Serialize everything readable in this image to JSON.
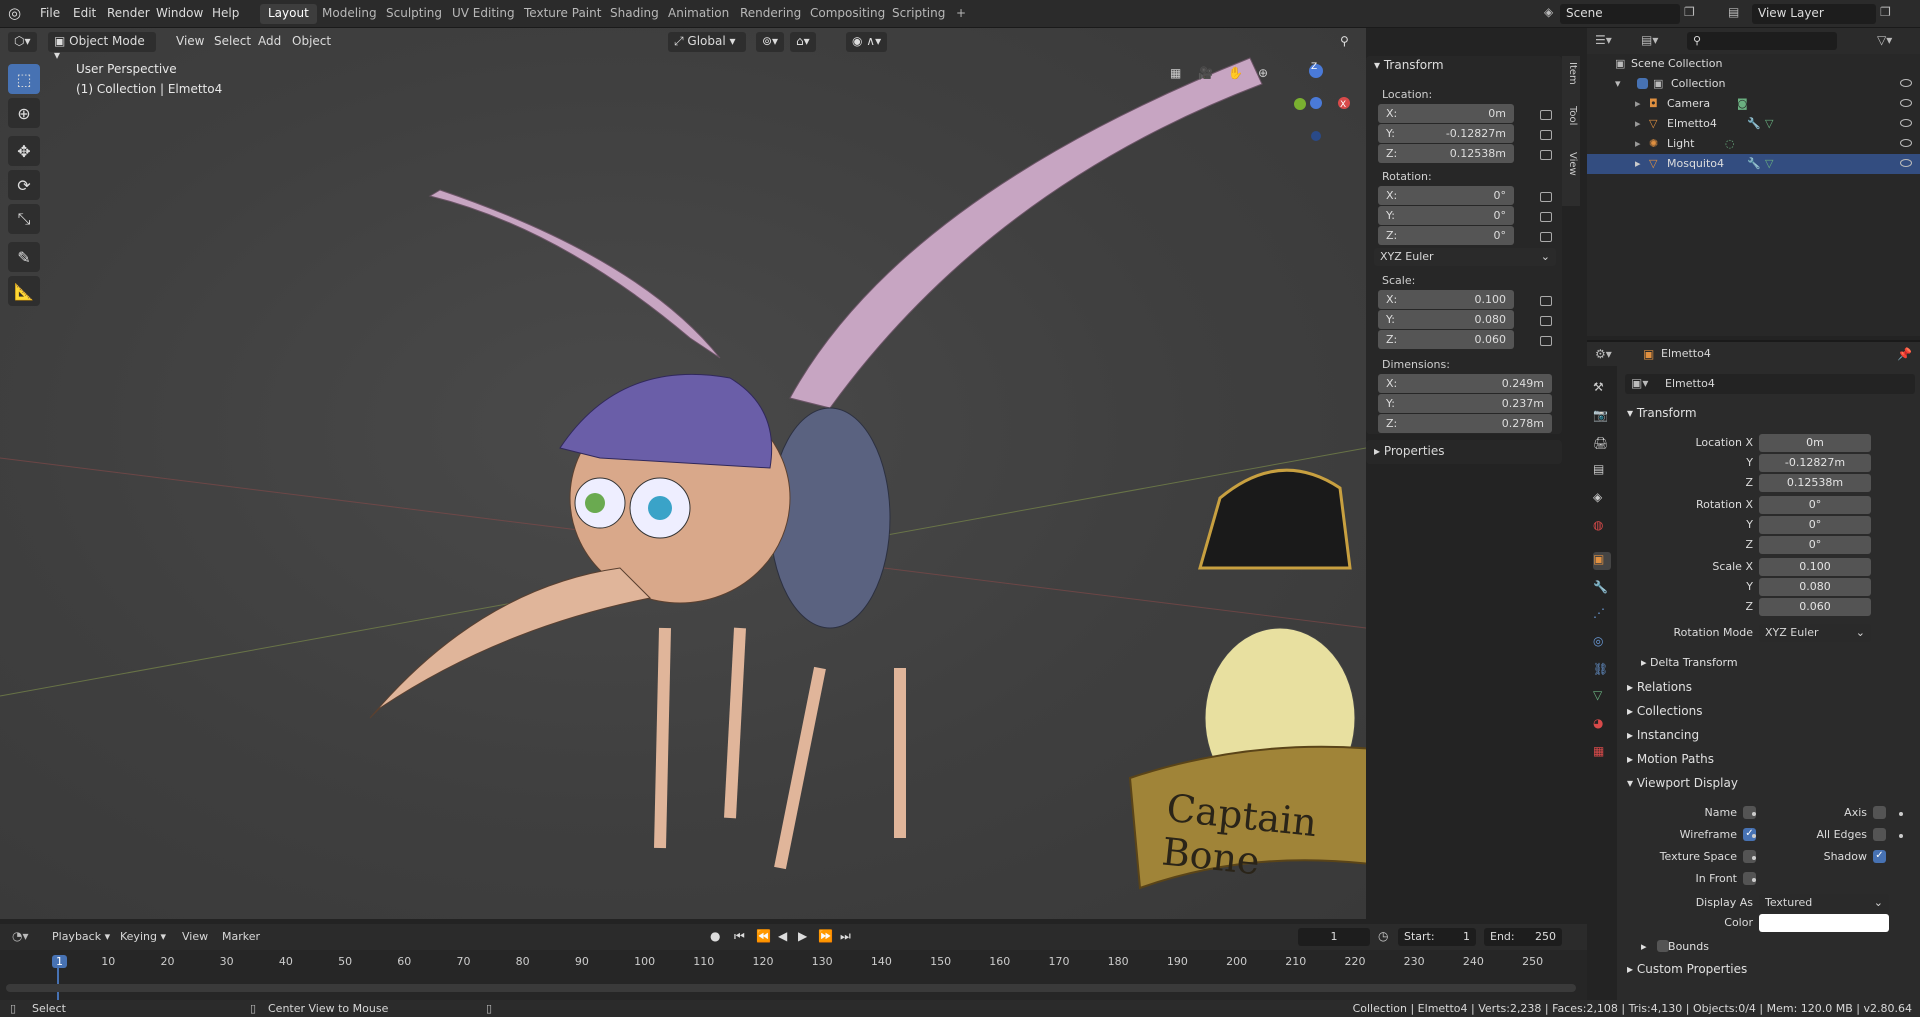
{
  "topbar": {
    "menus": [
      "File",
      "Edit",
      "Render",
      "Window",
      "Help"
    ],
    "workspaces": [
      "Layout",
      "Modeling",
      "Sculpting",
      "UV Editing",
      "Texture Paint",
      "Shading",
      "Animation",
      "Rendering",
      "Compositing",
      "Scripting"
    ],
    "active_workspace": "Layout",
    "add_tab": "+",
    "scene": "Scene",
    "view_layer": "View Layer"
  },
  "viewport": {
    "mode": "Object Mode",
    "menus": [
      "View",
      "Select",
      "Add",
      "Object"
    ],
    "orientation": "Global",
    "info_line1": "User Perspective",
    "info_line2": "(1) Collection | Elmetto4",
    "gizmo_axes": {
      "x": "X",
      "y": "Y",
      "z": "Z"
    },
    "logo_text": "Captain Bone"
  },
  "npanel": {
    "title": "Transform",
    "location_label": "Location:",
    "location": [
      {
        "axis": "X:",
        "value": "0m"
      },
      {
        "axis": "Y:",
        "value": "-0.12827m"
      },
      {
        "axis": "Z:",
        "value": "0.12538m"
      }
    ],
    "rotation_label": "Rotation:",
    "rotation": [
      {
        "axis": "X:",
        "value": "0°"
      },
      {
        "axis": "Y:",
        "value": "0°"
      },
      {
        "axis": "Z:",
        "value": "0°"
      }
    ],
    "rotation_mode": "XYZ Euler",
    "scale_label": "Scale:",
    "scale": [
      {
        "axis": "X:",
        "value": "0.100"
      },
      {
        "axis": "Y:",
        "value": "0.080"
      },
      {
        "axis": "Z:",
        "value": "0.060"
      }
    ],
    "dimensions_label": "Dimensions:",
    "dimensions": [
      {
        "axis": "X:",
        "value": "0.249m"
      },
      {
        "axis": "Y:",
        "value": "0.237m"
      },
      {
        "axis": "Z:",
        "value": "0.278m"
      }
    ],
    "properties_label": "Properties",
    "tabs": [
      "Item",
      "Tool",
      "View"
    ]
  },
  "outliner": {
    "root": "Scene Collection",
    "collection": "Collection",
    "items": [
      {
        "name": "Camera",
        "selected": false
      },
      {
        "name": "Elmetto4",
        "selected": false
      },
      {
        "name": "Light",
        "selected": false
      },
      {
        "name": "Mosquito4",
        "selected": true
      }
    ]
  },
  "properties": {
    "object_name_header": "Elmetto4",
    "object_name": "Elmetto4",
    "transform_title": "Transform",
    "location_x_label": "Location X",
    "y_label": "Y",
    "z_label": "Z",
    "location": [
      "0m",
      "-0.12827m",
      "0.12538m"
    ],
    "rotation_x_label": "Rotation X",
    "rotation": [
      "0°",
      "0°",
      "0°"
    ],
    "scale_x_label": "Scale X",
    "scale": [
      "0.100",
      "0.080",
      "0.060"
    ],
    "rotation_mode_label": "Rotation Mode",
    "rotation_mode": "XYZ Euler",
    "delta_transform": "Delta Transform",
    "sections": [
      "Relations",
      "Collections",
      "Instancing",
      "Motion Paths"
    ],
    "viewport_display": "Viewport Display",
    "vd_name": "Name",
    "vd_axis": "Axis",
    "vd_wireframe": "Wireframe",
    "vd_all_edges": "All Edges",
    "vd_texture_space": "Texture Space",
    "vd_shadow": "Shadow",
    "vd_in_front": "In Front",
    "display_as_label": "Display As",
    "display_as": "Textured",
    "color_label": "Color",
    "bounds": "Bounds",
    "custom_properties": "Custom Properties"
  },
  "timeline": {
    "menus": [
      "Playback",
      "Keying",
      "View",
      "Marker"
    ],
    "current_frame": "1",
    "start_label": "Start:",
    "start": "1",
    "end_label": "End:",
    "end": "250",
    "ticks": [
      "1",
      "10",
      "20",
      "30",
      "40",
      "50",
      "60",
      "70",
      "80",
      "90",
      "100",
      "110",
      "120",
      "130",
      "140",
      "150",
      "160",
      "170",
      "180",
      "190",
      "200",
      "210",
      "220",
      "230",
      "240",
      "250"
    ]
  },
  "statusbar": {
    "select": "Select",
    "center_view": "Center View to Mouse",
    "stats": "Collection | Elmetto4 | Verts:2,238 | Faces:2,108 | Tris:4,130 | Objects:0/4 | Mem: 120.0 MB | v2.80.64"
  },
  "colors": {
    "accent": "#4772b3",
    "selected_row": "#334d80",
    "viewport_bg": "#3f3f3f"
  }
}
